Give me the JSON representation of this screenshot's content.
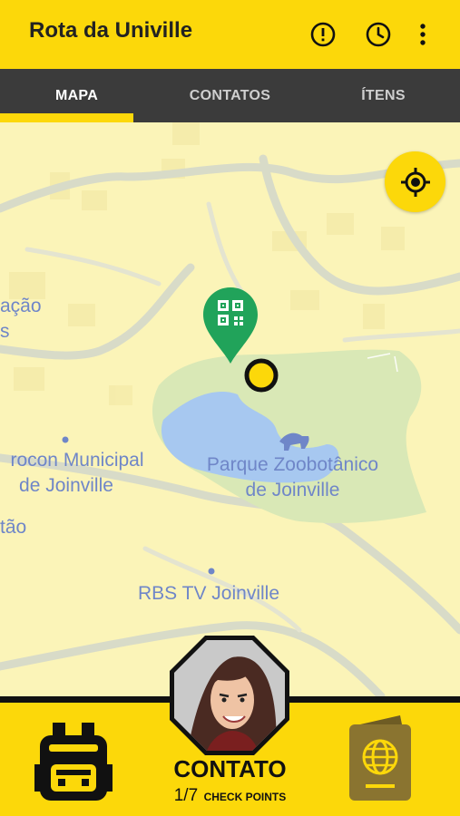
{
  "app_bar": {
    "title": "Rota da Univille",
    "icons": [
      "alert-circle-icon",
      "clock-icon",
      "more-vert-icon"
    ]
  },
  "tabs": [
    {
      "label": "MAPA",
      "active": true
    },
    {
      "label": "CONTATOS",
      "active": false
    },
    {
      "label": "ÍTENS",
      "active": false
    }
  ],
  "map": {
    "labels": {
      "partial_top_left_1": "ação",
      "partial_top_left_2": "s",
      "procon_line1": "rocon Municipal",
      "procon_line2": "de Joinville",
      "partial_left": "tão",
      "park_line1": "Parque Zoobotânico",
      "park_line2": "de Joinville",
      "rbs": "RBS TV Joinville"
    },
    "markers": [
      "qr-code-pin-icon",
      "user-location-dot"
    ],
    "locate_button_icon": "crosshair-icon"
  },
  "bottom_bar": {
    "left_icon": "backpack-icon",
    "avatar": "contact-avatar",
    "contact_label": "CONTATO",
    "checkpoint_count": "1/7",
    "checkpoint_label": "CHECK POINTS",
    "right_icon": "passport-icon"
  },
  "colors": {
    "accent": "#fcd80a",
    "tab_bar": "#3b3b3b",
    "map_bg": "#fbf4b8",
    "park_green": "#d9e8b6",
    "water": "#a7c8f0",
    "pin_green": "#21a35a",
    "label_blue": "#6f86c8",
    "passport_brown": "#8a7430"
  }
}
